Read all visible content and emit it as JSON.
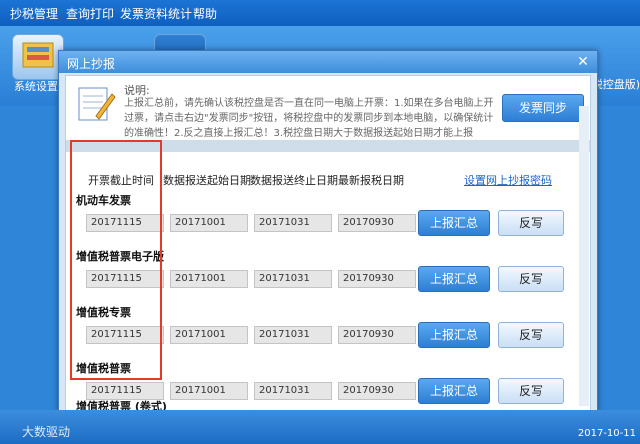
{
  "menu": {
    "items": [
      "抄税管理",
      "查询打印",
      "发票资料统计",
      "帮助"
    ]
  },
  "toolbar": {
    "system_label": "系统设置",
    "right_label": "税控盘版)"
  },
  "dialog": {
    "title": "网上抄报",
    "note_label": "说明:",
    "note_text": "上报汇总前，请先确认该税控盘是否一直在同一电脑上开票：1.如果在多台电脑上开过票，请点击右边\"发票同步\"按钮，将税控盘中的发票同步到本地电脑，以确保统计的准确性！2.反之直接上报汇总！3.税控盘日期大于数据报送起始日期才能上报",
    "sync_button": "发票同步",
    "columns": [
      "开票截止时间",
      "数据报送起始日期",
      "数据报送终止日期",
      "最新报税日期"
    ],
    "settings_link": "设置网上抄报密码",
    "sections": [
      {
        "title": "机动车发票",
        "values": [
          "20171115",
          "20171001",
          "20171031",
          "20170930"
        ],
        "report": "上报汇总",
        "copy": "反写"
      },
      {
        "title": "增值税普票电子版",
        "values": [
          "20171115",
          "20171001",
          "20171031",
          "20170930"
        ],
        "report": "上报汇总",
        "copy": "反写"
      },
      {
        "title": "增值税专票",
        "values": [
          "20171115",
          "20171001",
          "20171031",
          "20170930"
        ],
        "report": "上报汇总",
        "copy": "反写"
      },
      {
        "title": "增值税普票",
        "values": [
          "20171115",
          "20171001",
          "20171031",
          "20170930"
        ],
        "report": "上报汇总",
        "copy": "反写"
      },
      {
        "title": "增值税普票 (卷式)"
      }
    ]
  },
  "footer": {
    "watermark": "大数驱动",
    "date": "2017-10-11"
  },
  "colors": {
    "highlight": "#e23b2a",
    "accent": "#2d7fd5"
  }
}
